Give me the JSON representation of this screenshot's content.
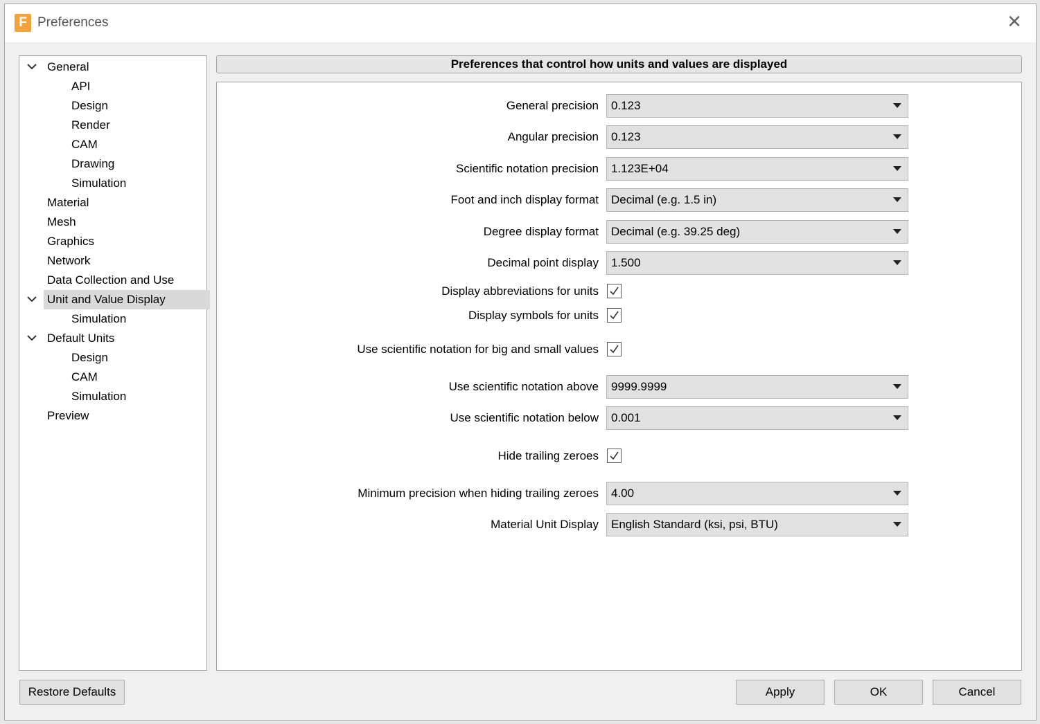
{
  "window": {
    "title": "Preferences",
    "app_icon_letter": "F",
    "close_glyph": "✕"
  },
  "nav": {
    "items": [
      {
        "label": "General",
        "level": 0,
        "expanded": true
      },
      {
        "label": "API",
        "level": 1
      },
      {
        "label": "Design",
        "level": 1
      },
      {
        "label": "Render",
        "level": 1
      },
      {
        "label": "CAM",
        "level": 1
      },
      {
        "label": "Drawing",
        "level": 1
      },
      {
        "label": "Simulation",
        "level": 1
      },
      {
        "label": "Material",
        "level": 0
      },
      {
        "label": "Mesh",
        "level": 0
      },
      {
        "label": "Graphics",
        "level": 0
      },
      {
        "label": "Network",
        "level": 0
      },
      {
        "label": "Data Collection and Use",
        "level": 0
      },
      {
        "label": "Unit and Value Display",
        "level": 0,
        "expanded": true,
        "selected": true
      },
      {
        "label": "Simulation",
        "level": 1
      },
      {
        "label": "Default Units",
        "level": 0,
        "expanded": true
      },
      {
        "label": "Design",
        "level": 1
      },
      {
        "label": "CAM",
        "level": 1
      },
      {
        "label": "Simulation",
        "level": 1
      },
      {
        "label": "Preview",
        "level": 0
      }
    ]
  },
  "panel": {
    "header": "Preferences that control how units and values are displayed",
    "general_precision": {
      "label": "General precision",
      "value": "0.123"
    },
    "angular_precision": {
      "label": "Angular precision",
      "value": "0.123"
    },
    "scientific_precision": {
      "label": "Scientific notation precision",
      "value": "1.123E+04"
    },
    "foot_inch_format": {
      "label": "Foot and inch display format",
      "value": "Decimal (e.g. 1.5 in)"
    },
    "degree_format": {
      "label": "Degree display format",
      "value": "Decimal (e.g. 39.25 deg)"
    },
    "decimal_point": {
      "label": "Decimal point display",
      "value": "1.500"
    },
    "abbreviations": {
      "label": "Display abbreviations for units",
      "checked": true
    },
    "symbols": {
      "label": "Display symbols for units",
      "checked": true
    },
    "use_scientific": {
      "label": "Use scientific notation for big and small values",
      "checked": true
    },
    "sci_above": {
      "label": "Use scientific notation above",
      "value": "9999.9999"
    },
    "sci_below": {
      "label": "Use scientific notation below",
      "value": "0.001"
    },
    "hide_zeroes": {
      "label": "Hide trailing zeroes",
      "checked": true
    },
    "min_precision": {
      "label": "Minimum precision when hiding trailing zeroes",
      "value": "4.00"
    },
    "material_unit": {
      "label": "Material Unit Display",
      "value": "English Standard (ksi, psi, BTU)"
    }
  },
  "buttons": {
    "restore": "Restore Defaults",
    "apply": "Apply",
    "ok": "OK",
    "cancel": "Cancel"
  }
}
